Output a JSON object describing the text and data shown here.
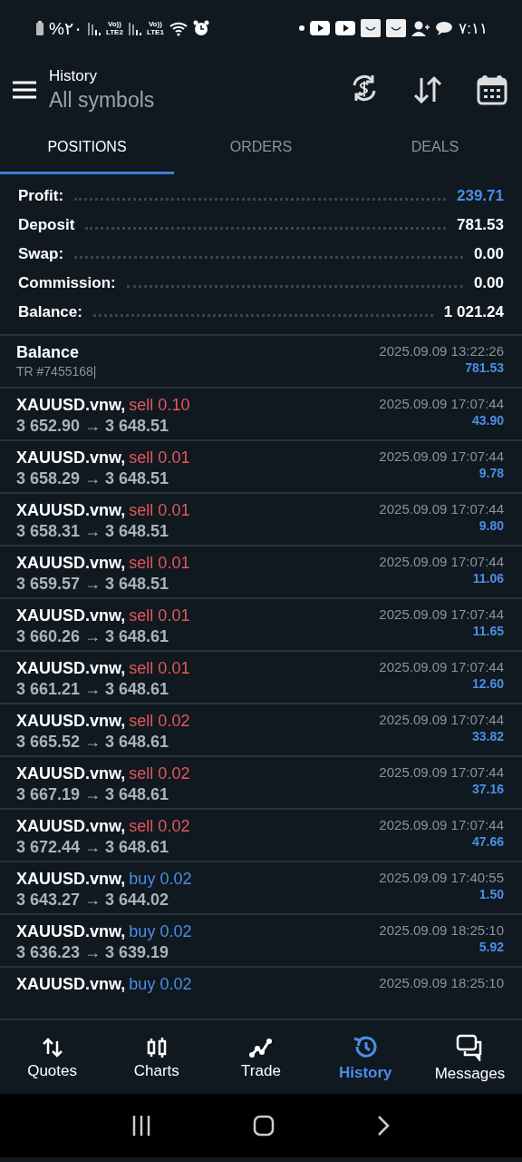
{
  "status_bar": {
    "battery": "%۲۰",
    "sim_labels": [
      {
        "top": "Vo))",
        "bottom": "LTE2"
      },
      {
        "top": "Vo))",
        "bottom": "LTE1"
      }
    ],
    "time": "۷:۱۱"
  },
  "header": {
    "title": "History",
    "subtitle": "All symbols"
  },
  "tabs": [
    {
      "label": "POSITIONS",
      "selected": true
    },
    {
      "label": "ORDERS",
      "selected": false
    },
    {
      "label": "DEALS",
      "selected": false
    }
  ],
  "summary": [
    {
      "label": "Profit:",
      "value": "239.71",
      "highlight": true
    },
    {
      "label": "Deposit",
      "value": "781.53",
      "highlight": false
    },
    {
      "label": "Swap:",
      "value": "0.00",
      "highlight": false
    },
    {
      "label": "Commission:",
      "value": "0.00",
      "highlight": false
    },
    {
      "label": "Balance:",
      "value": "1 021.24",
      "highlight": false
    }
  ],
  "deals": [
    {
      "kind": "balance",
      "title": "Balance",
      "comment": "TR #7455168|",
      "time": "2025.09.09 13:22:26",
      "amount": "781.53"
    },
    {
      "kind": "trade",
      "symbol": "XAUUSD.vnw,",
      "side": "sell",
      "volume": "0.10",
      "prices": "3 652.90 → 3 648.51",
      "time": "2025.09.09 17:07:44",
      "amount": "43.90"
    },
    {
      "kind": "trade",
      "symbol": "XAUUSD.vnw,",
      "side": "sell",
      "volume": "0.01",
      "prices": "3 658.29 → 3 648.51",
      "time": "2025.09.09 17:07:44",
      "amount": "9.78"
    },
    {
      "kind": "trade",
      "symbol": "XAUUSD.vnw,",
      "side": "sell",
      "volume": "0.01",
      "prices": "3 658.31 → 3 648.51",
      "time": "2025.09.09 17:07:44",
      "amount": "9.80"
    },
    {
      "kind": "trade",
      "symbol": "XAUUSD.vnw,",
      "side": "sell",
      "volume": "0.01",
      "prices": "3 659.57 → 3 648.51",
      "time": "2025.09.09 17:07:44",
      "amount": "11.06"
    },
    {
      "kind": "trade",
      "symbol": "XAUUSD.vnw,",
      "side": "sell",
      "volume": "0.01",
      "prices": "3 660.26 → 3 648.61",
      "time": "2025.09.09 17:07:44",
      "amount": "11.65"
    },
    {
      "kind": "trade",
      "symbol": "XAUUSD.vnw,",
      "side": "sell",
      "volume": "0.01",
      "prices": "3 661.21 → 3 648.61",
      "time": "2025.09.09 17:07:44",
      "amount": "12.60"
    },
    {
      "kind": "trade",
      "symbol": "XAUUSD.vnw,",
      "side": "sell",
      "volume": "0.02",
      "prices": "3 665.52 → 3 648.61",
      "time": "2025.09.09 17:07:44",
      "amount": "33.82"
    },
    {
      "kind": "trade",
      "symbol": "XAUUSD.vnw,",
      "side": "sell",
      "volume": "0.02",
      "prices": "3 667.19 → 3 648.61",
      "time": "2025.09.09 17:07:44",
      "amount": "37.16"
    },
    {
      "kind": "trade",
      "symbol": "XAUUSD.vnw,",
      "side": "sell",
      "volume": "0.02",
      "prices": "3 672.44 → 3 648.61",
      "time": "2025.09.09 17:07:44",
      "amount": "47.66"
    },
    {
      "kind": "trade",
      "symbol": "XAUUSD.vnw,",
      "side": "buy",
      "volume": "0.02",
      "prices": "3 643.27 → 3 644.02",
      "time": "2025.09.09 17:40:55",
      "amount": "1.50"
    },
    {
      "kind": "trade",
      "symbol": "XAUUSD.vnw,",
      "side": "buy",
      "volume": "0.02",
      "prices": "3 636.23 → 3 639.19",
      "time": "2025.09.09 18:25:10",
      "amount": "5.92"
    },
    {
      "kind": "trade_partial",
      "symbol": "XAUUSD.vnw,",
      "side": "buy",
      "volume": "0.02",
      "time": "2025.09.09 18:25:10"
    }
  ],
  "bottom_nav": [
    {
      "label": "Quotes",
      "selected": false
    },
    {
      "label": "Charts",
      "selected": false
    },
    {
      "label": "Trade",
      "selected": false
    },
    {
      "label": "History",
      "selected": true
    },
    {
      "label": "Messages",
      "selected": false
    }
  ]
}
